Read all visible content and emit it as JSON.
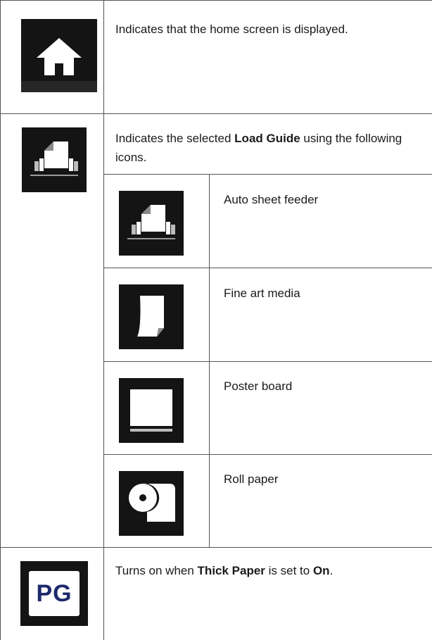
{
  "rows": [
    {
      "icon": "home-icon",
      "description": "Indicates that the home screen is displayed."
    },
    {
      "icon": "auto-sheet-feeder-icon",
      "description_before": "Indicates the selected ",
      "description_bold": "Load Guide",
      "description_after": " using the following icons.",
      "sub_items": [
        {
          "icon": "auto-sheet-feeder-icon",
          "label": "Auto sheet feeder"
        },
        {
          "icon": "fine-art-media-icon",
          "label": "Fine art media"
        },
        {
          "icon": "poster-board-icon",
          "label": "Poster board"
        },
        {
          "icon": "roll-paper-icon",
          "label": "Roll paper"
        }
      ]
    },
    {
      "icon": "pg-thick-paper-icon",
      "icon_text": "PG",
      "description_before": "Turns on when ",
      "description_bold_1": "Thick Paper",
      "description_middle": " is set to ",
      "description_bold_2": "On",
      "description_after": "."
    }
  ]
}
